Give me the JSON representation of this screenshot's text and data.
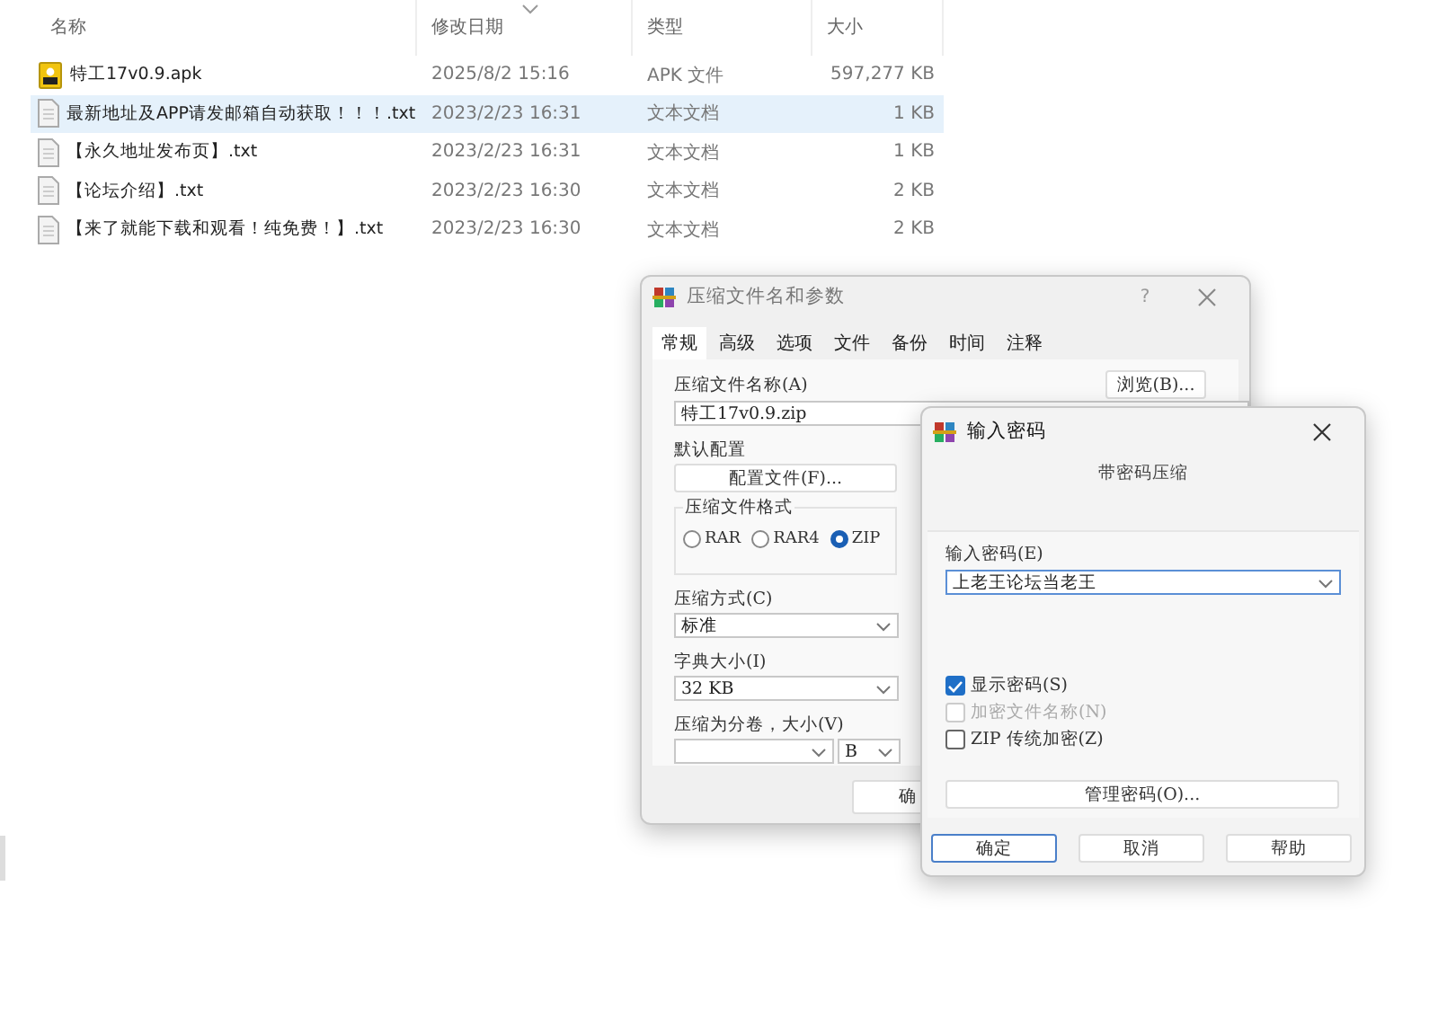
{
  "explorer": {
    "columns": [
      "名称",
      "修改日期",
      "类型",
      "大小"
    ],
    "rows": [
      {
        "kind": "apk",
        "name": "特工17v0.9.apk",
        "modified": "2025/8/2 15:16",
        "type": "APK 文件",
        "size": "597,277 KB",
        "selected": false
      },
      {
        "kind": "txt",
        "name": "最新地址及APP请发邮箱自动获取！！！.txt",
        "modified": "2023/2/23 16:31",
        "type": "文本文档",
        "size": "1 KB",
        "selected": true
      },
      {
        "kind": "txt",
        "name": "【永久地址发布页】.txt",
        "modified": "2023/2/23 16:31",
        "type": "文本文档",
        "size": "1 KB",
        "selected": false
      },
      {
        "kind": "txt",
        "name": "【论坛介绍】.txt",
        "modified": "2023/2/23 16:30",
        "type": "文本文档",
        "size": "2 KB",
        "selected": false
      },
      {
        "kind": "txt",
        "name": "【来了就能下载和观看！纯免费！】.txt",
        "modified": "2023/2/23 16:30",
        "type": "文本文档",
        "size": "2 KB",
        "selected": false
      }
    ]
  },
  "archive_dialog": {
    "title": "压缩文件名和参数",
    "help": "?",
    "tabs": [
      {
        "label": "常规",
        "selected": true
      },
      {
        "label": "高级",
        "selected": false
      },
      {
        "label": "选项",
        "selected": false
      },
      {
        "label": "文件",
        "selected": false
      },
      {
        "label": "备份",
        "selected": false
      },
      {
        "label": "时间",
        "selected": false
      },
      {
        "label": "注释",
        "selected": false
      }
    ],
    "archive_name_label": "压缩文件名称(A)",
    "archive_name": "特工17v0.9.zip",
    "browse_button": "浏览(B)...",
    "profile_label": "默认配置",
    "profile_button": "配置文件(F)...",
    "format_group": {
      "label": "压缩文件格式",
      "options": [
        {
          "label": "RAR",
          "selected": false
        },
        {
          "label": "RAR4",
          "selected": false
        },
        {
          "label": "ZIP",
          "selected": true
        }
      ]
    },
    "method_label": "压缩方式(C)",
    "method": "标准",
    "dictionary_label": "字典大小(I)",
    "dictionary": "32 KB",
    "split_label": "压缩为分卷，大小(V)",
    "split_unit": "B",
    "ok_button": "确"
  },
  "password_dialog": {
    "title": "输入密码",
    "subtitle": "带密码压缩",
    "password_label": "输入密码(E)",
    "password": "上老王论坛当老王",
    "options": [
      {
        "label": "显示密码(S)",
        "checked": true,
        "disabled": false
      },
      {
        "label": "加密文件名称(N)",
        "checked": false,
        "disabled": true
      },
      {
        "label": "ZIP 传统加密(Z)",
        "checked": false,
        "disabled": false
      }
    ],
    "manage_button": "管理密码(O)...",
    "buttons": [
      {
        "label": "确定",
        "default": true
      },
      {
        "label": "取消",
        "default": false
      },
      {
        "label": "帮助",
        "default": false
      }
    ]
  }
}
